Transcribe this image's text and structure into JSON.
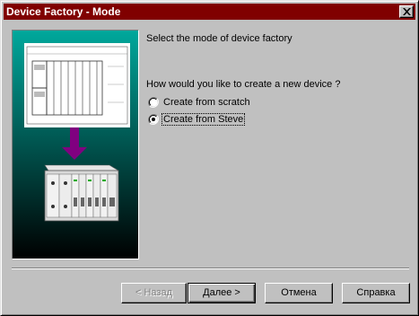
{
  "window": {
    "title": "Device Factory - Mode",
    "close_icon": "close-icon"
  },
  "content": {
    "heading": "Select the mode of device factory",
    "question": "How would you like to create a new device ?",
    "options": [
      {
        "label": "Create from scratch",
        "selected": false
      },
      {
        "label": "Create from Steve",
        "selected": true
      }
    ]
  },
  "illustration": {
    "icon": "device-schematic-to-hardware-illustration",
    "colors": {
      "top": "#ffffff",
      "gradient_top": "#008f86",
      "gradient_bottom": "#000000",
      "arrow": "#800080"
    }
  },
  "buttons": {
    "back": "< Назад",
    "next": "Далее >",
    "cancel": "Отмена",
    "help": "Справка"
  },
  "colors": {
    "titlebar": "#800000",
    "face": "#c0c0c0"
  }
}
